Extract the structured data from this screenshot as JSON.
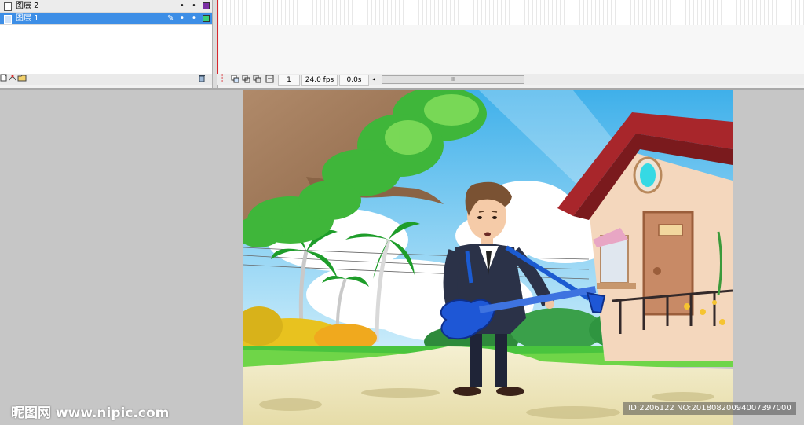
{
  "layers": [
    {
      "name": "图层 2",
      "color": "#7b2fa5",
      "selected": false
    },
    {
      "name": "图层 1",
      "color": "#37d07a",
      "selected": true
    }
  ],
  "timeline": {
    "frame": "1",
    "fps": "24.0 fps",
    "time": "0.0s",
    "scroll_grip": "III"
  },
  "icons": {
    "pencil": "✎",
    "dot": "•",
    "trash": "🗑",
    "playhead": "⫶"
  },
  "watermark": {
    "left": "昵图网 www.nipic.com",
    "right": "ID:2206122 NO:20180820094007397000"
  },
  "colors": {
    "selection": "#3d8ee6",
    "sky": "#67c3ef",
    "grass": "#3cb53c"
  }
}
